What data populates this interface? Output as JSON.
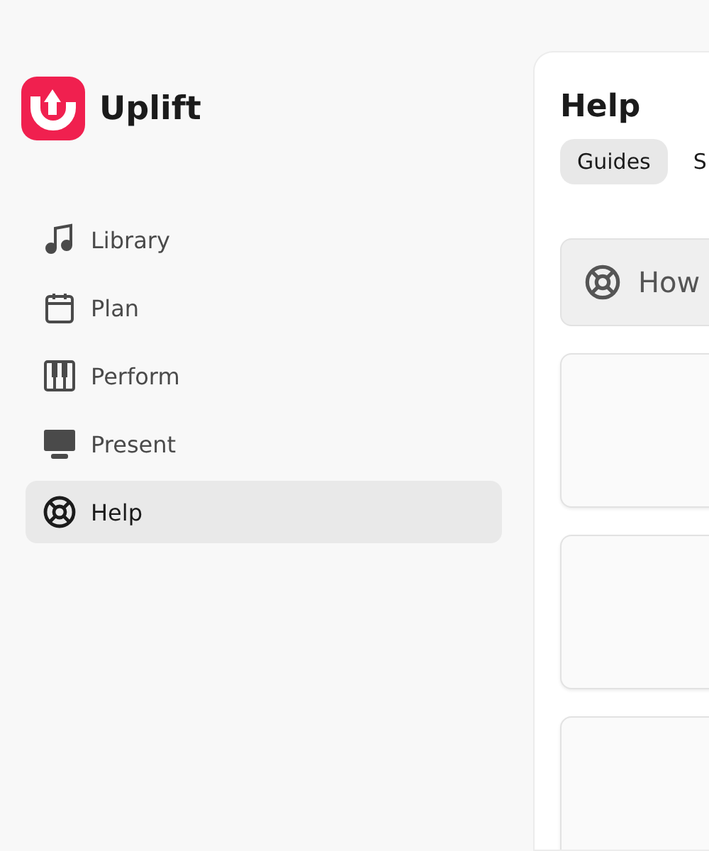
{
  "app": {
    "name": "Uplift"
  },
  "sidebar": {
    "items": [
      {
        "label": "Library",
        "kind": "music",
        "selected": false
      },
      {
        "label": "Plan",
        "kind": "calendar",
        "selected": false
      },
      {
        "label": "Perform",
        "kind": "piano",
        "selected": false
      },
      {
        "label": "Present",
        "kind": "monitor",
        "selected": false
      },
      {
        "label": "Help",
        "kind": "lifebuoy",
        "selected": true
      }
    ]
  },
  "main": {
    "title": "Help",
    "tabs": [
      {
        "label": "Guides",
        "selected": true
      },
      {
        "label": "S",
        "selected": false
      }
    ],
    "banner": {
      "text": "How"
    },
    "cards": [
      {
        "kind": "empty"
      },
      {
        "kind": "empty"
      },
      {
        "kind": "empty"
      }
    ]
  }
}
